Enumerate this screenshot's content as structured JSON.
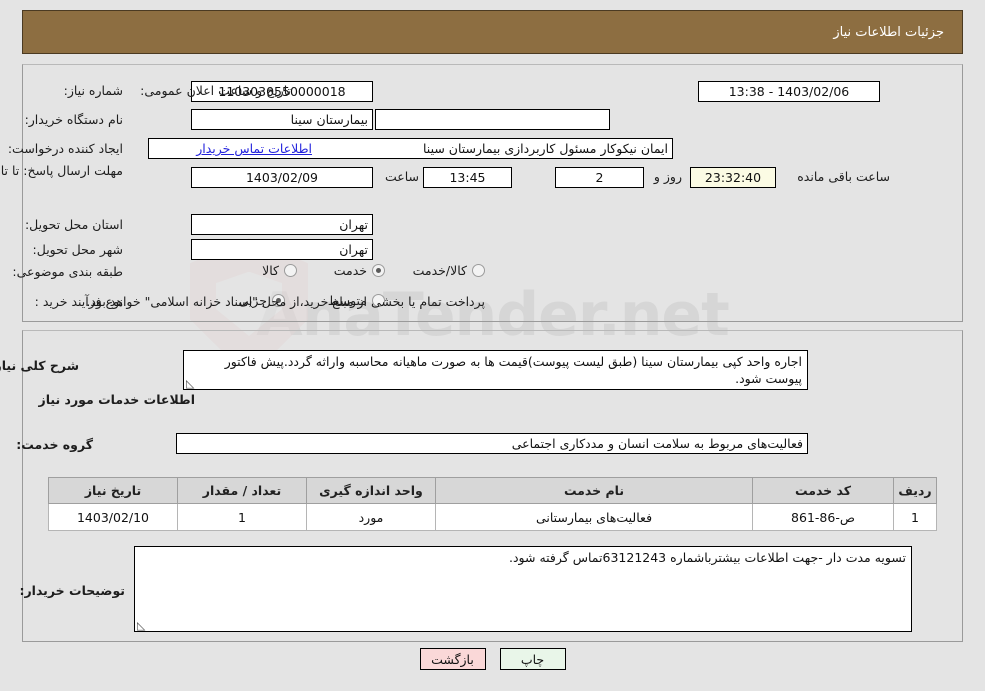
{
  "header": {
    "title": "جزئیات اطلاعات نیاز",
    "bg": "#8d6e41",
    "fg": "#ffffff"
  },
  "watermark": {
    "text": "AnaTender.net"
  },
  "top_form": {
    "need_number": {
      "label": "شماره نیاز:",
      "value": "1103030550000018"
    },
    "public_announce": {
      "label": "تاریخ و ساعت اعلان عمومی:",
      "value": "1403/02/06 - 13:38"
    },
    "buyer_org": {
      "label": "نام دستگاه خریدار:",
      "value": "بیمارستان سینا"
    },
    "buyer_org_extra": {
      "value": "بیمارستان سینا"
    },
    "requester": {
      "label": "ایجاد کننده درخواست:",
      "value": "ایمان نیکوکار مسئول کاربردازی  بیمارستان سینا"
    },
    "buyer_contact_link": "اطلاعات تماس خریدار",
    "deadline": {
      "label": "مهلت ارسال پاسخ: تا تاریخ:",
      "date": "1403/02/09",
      "hour_label": "ساعت",
      "hour": "13:45",
      "days": "2",
      "days_label": "روز و",
      "countdown": "23:32:40",
      "remain_label": "ساعت باقی مانده"
    },
    "province": {
      "label": "استان محل تحویل:",
      "value": "تهران"
    },
    "city": {
      "label": "شهر محل تحویل:",
      "value": "تهران"
    },
    "category": {
      "label": "طبقه بندی موضوعی:",
      "options": [
        "کالا",
        "خدمت",
        "کالا/خدمت"
      ],
      "selected_index": 1
    },
    "process_type": {
      "label": "نوع فرآیند خرید :",
      "options": [
        "جزیی",
        "متوسط"
      ],
      "selected_index": 0,
      "note": "پرداخت تمام یا بخشی از مبلغ خرید،از محل \"اسناد خزانه اسلامی\" خواهد بود."
    }
  },
  "bottom": {
    "need_desc": {
      "label": "شرح کلی نیاز:",
      "value": "اجاره واحد کپی بیمارستان سینا (طبق لیست پیوست)قیمت ها به صورت ماهیانه محاسبه واراثه گردد.پیش فاکتور پیوست شود."
    },
    "services_heading": "اطلاعات خدمات مورد نیاز",
    "service_group": {
      "label": "گروه خدمت:",
      "value": "فعالیت‌های مربوط به سلامت انسان و مددکاری اجتماعی"
    },
    "table": {
      "columns": [
        "ردیف",
        "کد خدمت",
        "نام خدمت",
        "واحد اندازه گیری",
        "تعداد / مقدار",
        "تاریخ نیاز"
      ],
      "rows": [
        {
          "row_no": "1",
          "service_code": "ص-86-861",
          "service_name": "فعالیت‌های بیمارستانی",
          "unit": "مورد",
          "quantity": "1",
          "need_date": "1403/02/10"
        }
      ]
    },
    "buyer_notes": {
      "label": "توضیحات خریدار:",
      "value": "تسویه مدت دار -جهت اطلاعات بیشترباشماره 63121243تماس گرفته شود."
    }
  },
  "buttons": {
    "print": "چاپ",
    "back": "بازگشت"
  }
}
